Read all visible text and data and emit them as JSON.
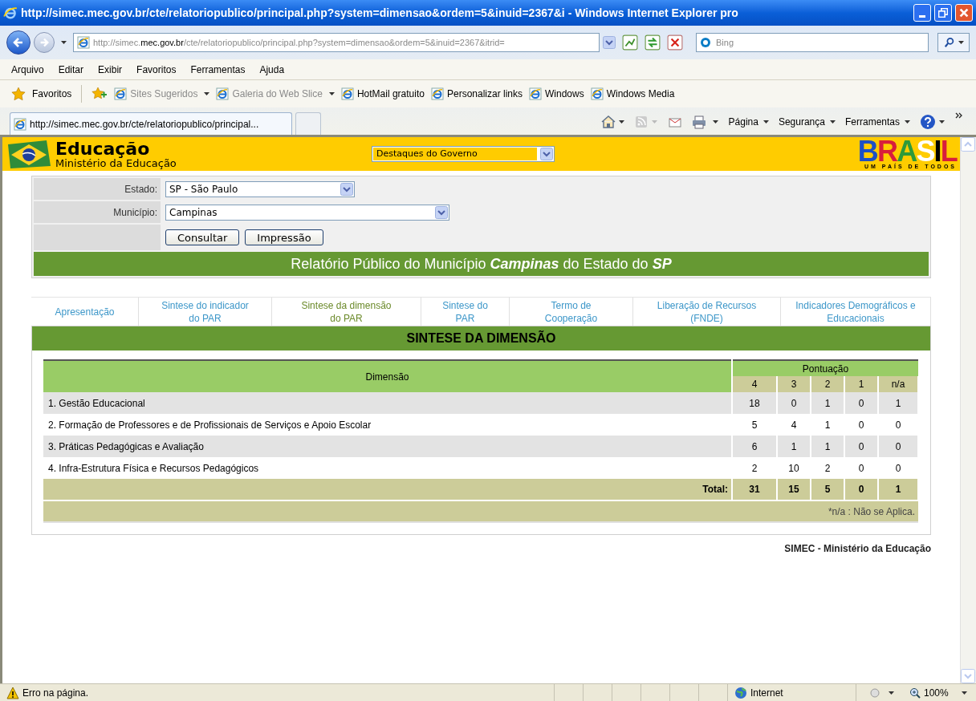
{
  "window": {
    "title": "http://simec.mec.gov.br/cte/relatoriopublico/principal.php?system=dimensao&ordem=5&inuid=2367&i - Windows Internet Explorer pro"
  },
  "address_bar": {
    "prefix": "http://simec.",
    "domain": "mec.gov.br",
    "path": "/cte/relatoriopublico/principal.php?system=dimensao&ordem=5&inuid=2367&itrid="
  },
  "search": {
    "placeholder": "Bing"
  },
  "menu": [
    "Arquivo",
    "Editar",
    "Exibir",
    "Favoritos",
    "Ferramentas",
    "Ajuda"
  ],
  "favorites": {
    "label": "Favoritos",
    "links": [
      {
        "label": "Sites Sugeridos",
        "disabled": true,
        "dropdown": true
      },
      {
        "label": "Galeria do Web Slice",
        "disabled": true,
        "dropdown": true
      },
      {
        "label": "HotMail gratuito",
        "disabled": false,
        "dropdown": false
      },
      {
        "label": "Personalizar links",
        "disabled": false,
        "dropdown": false
      },
      {
        "label": "Windows",
        "disabled": false,
        "dropdown": false
      },
      {
        "label": "Windows Media",
        "disabled": false,
        "dropdown": false
      }
    ]
  },
  "browser_tab": {
    "title": "http://simec.mec.gov.br/cte/relatoriopublico/principal..."
  },
  "command_bar": [
    "Página",
    "Segurança",
    "Ferramentas"
  ],
  "header": {
    "title": "Educação",
    "subtitle": "Ministério da Educação",
    "dropdown": "Destaques do Governo",
    "logo": "BRASIL",
    "tagline": "UM PAÍS DE TODOS"
  },
  "form": {
    "fields": [
      {
        "label": "Estado:",
        "value": "SP - São Paulo"
      },
      {
        "label": "Município:",
        "value": "Campinas"
      }
    ],
    "buttons": [
      "Consultar",
      "Impressão"
    ]
  },
  "report_title": "Relatório Público do Município **Campinas** do Estado do **SP**",
  "tabs": [
    {
      "label": "Apresentação",
      "selected": false
    },
    {
      "label": "Sintese do indicador\ndo PAR",
      "selected": false
    },
    {
      "label": "Sintese da dimensão\ndo PAR",
      "selected": true
    },
    {
      "label": "Sintese do\nPAR",
      "selected": false
    },
    {
      "label": "Termo de\nCooperação",
      "selected": false
    },
    {
      "label": "Liberação de Recursos\n(FNDE)",
      "selected": false
    },
    {
      "label": "Indicadores Demográficos e\nEducacionais",
      "selected": false
    }
  ],
  "section_title": "SINTESE DA DIMENSÃO",
  "table": {
    "dimension_header": "Dimensão",
    "score_header": "Pontuação",
    "score_columns": [
      "4",
      "3",
      "2",
      "1",
      "n/a"
    ],
    "rows": [
      {
        "dimension": "1. Gestão Educacional",
        "scores": [
          "18",
          "0",
          "1",
          "0",
          "1"
        ]
      },
      {
        "dimension": "2. Formação de Professores e de Profissionais de Serviços e Apoio Escolar",
        "scores": [
          "5",
          "4",
          "1",
          "0",
          "0"
        ]
      },
      {
        "dimension": "3. Práticas Pedagógicas e Avaliação",
        "scores": [
          "6",
          "1",
          "1",
          "0",
          "0"
        ]
      },
      {
        "dimension": "4. Infra-Estrutura Física e Recursos Pedagógicos",
        "scores": [
          "2",
          "10",
          "2",
          "0",
          "0"
        ]
      }
    ],
    "total_label": "Total:",
    "totals": [
      "31",
      "15",
      "5",
      "0",
      "1"
    ],
    "footnote": "*n/a : Não se Aplica."
  },
  "footer": "SIMEC - Ministério da Educação",
  "status_bar": {
    "text": "Erro na página.",
    "zone": "Internet",
    "zoom": "100%"
  }
}
